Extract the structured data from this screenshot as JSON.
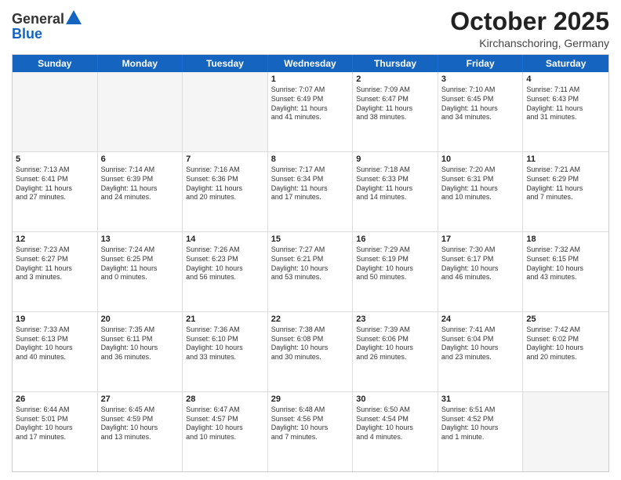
{
  "header": {
    "logo_general": "General",
    "logo_blue": "Blue",
    "month_title": "October 2025",
    "location": "Kirchanschoring, Germany"
  },
  "days_of_week": [
    "Sunday",
    "Monday",
    "Tuesday",
    "Wednesday",
    "Thursday",
    "Friday",
    "Saturday"
  ],
  "weeks": [
    [
      {
        "day": "",
        "lines": [],
        "empty": true
      },
      {
        "day": "",
        "lines": [],
        "empty": true
      },
      {
        "day": "",
        "lines": [],
        "empty": true
      },
      {
        "day": "1",
        "lines": [
          "Sunrise: 7:07 AM",
          "Sunset: 6:49 PM",
          "Daylight: 11 hours",
          "and 41 minutes."
        ]
      },
      {
        "day": "2",
        "lines": [
          "Sunrise: 7:09 AM",
          "Sunset: 6:47 PM",
          "Daylight: 11 hours",
          "and 38 minutes."
        ]
      },
      {
        "day": "3",
        "lines": [
          "Sunrise: 7:10 AM",
          "Sunset: 6:45 PM",
          "Daylight: 11 hours",
          "and 34 minutes."
        ]
      },
      {
        "day": "4",
        "lines": [
          "Sunrise: 7:11 AM",
          "Sunset: 6:43 PM",
          "Daylight: 11 hours",
          "and 31 minutes."
        ]
      }
    ],
    [
      {
        "day": "5",
        "lines": [
          "Sunrise: 7:13 AM",
          "Sunset: 6:41 PM",
          "Daylight: 11 hours",
          "and 27 minutes."
        ]
      },
      {
        "day": "6",
        "lines": [
          "Sunrise: 7:14 AM",
          "Sunset: 6:39 PM",
          "Daylight: 11 hours",
          "and 24 minutes."
        ]
      },
      {
        "day": "7",
        "lines": [
          "Sunrise: 7:16 AM",
          "Sunset: 6:36 PM",
          "Daylight: 11 hours",
          "and 20 minutes."
        ]
      },
      {
        "day": "8",
        "lines": [
          "Sunrise: 7:17 AM",
          "Sunset: 6:34 PM",
          "Daylight: 11 hours",
          "and 17 minutes."
        ]
      },
      {
        "day": "9",
        "lines": [
          "Sunrise: 7:18 AM",
          "Sunset: 6:33 PM",
          "Daylight: 11 hours",
          "and 14 minutes."
        ]
      },
      {
        "day": "10",
        "lines": [
          "Sunrise: 7:20 AM",
          "Sunset: 6:31 PM",
          "Daylight: 11 hours",
          "and 10 minutes."
        ]
      },
      {
        "day": "11",
        "lines": [
          "Sunrise: 7:21 AM",
          "Sunset: 6:29 PM",
          "Daylight: 11 hours",
          "and 7 minutes."
        ]
      }
    ],
    [
      {
        "day": "12",
        "lines": [
          "Sunrise: 7:23 AM",
          "Sunset: 6:27 PM",
          "Daylight: 11 hours",
          "and 3 minutes."
        ]
      },
      {
        "day": "13",
        "lines": [
          "Sunrise: 7:24 AM",
          "Sunset: 6:25 PM",
          "Daylight: 11 hours",
          "and 0 minutes."
        ]
      },
      {
        "day": "14",
        "lines": [
          "Sunrise: 7:26 AM",
          "Sunset: 6:23 PM",
          "Daylight: 10 hours",
          "and 56 minutes."
        ]
      },
      {
        "day": "15",
        "lines": [
          "Sunrise: 7:27 AM",
          "Sunset: 6:21 PM",
          "Daylight: 10 hours",
          "and 53 minutes."
        ]
      },
      {
        "day": "16",
        "lines": [
          "Sunrise: 7:29 AM",
          "Sunset: 6:19 PM",
          "Daylight: 10 hours",
          "and 50 minutes."
        ]
      },
      {
        "day": "17",
        "lines": [
          "Sunrise: 7:30 AM",
          "Sunset: 6:17 PM",
          "Daylight: 10 hours",
          "and 46 minutes."
        ]
      },
      {
        "day": "18",
        "lines": [
          "Sunrise: 7:32 AM",
          "Sunset: 6:15 PM",
          "Daylight: 10 hours",
          "and 43 minutes."
        ]
      }
    ],
    [
      {
        "day": "19",
        "lines": [
          "Sunrise: 7:33 AM",
          "Sunset: 6:13 PM",
          "Daylight: 10 hours",
          "and 40 minutes."
        ]
      },
      {
        "day": "20",
        "lines": [
          "Sunrise: 7:35 AM",
          "Sunset: 6:11 PM",
          "Daylight: 10 hours",
          "and 36 minutes."
        ]
      },
      {
        "day": "21",
        "lines": [
          "Sunrise: 7:36 AM",
          "Sunset: 6:10 PM",
          "Daylight: 10 hours",
          "and 33 minutes."
        ]
      },
      {
        "day": "22",
        "lines": [
          "Sunrise: 7:38 AM",
          "Sunset: 6:08 PM",
          "Daylight: 10 hours",
          "and 30 minutes."
        ]
      },
      {
        "day": "23",
        "lines": [
          "Sunrise: 7:39 AM",
          "Sunset: 6:06 PM",
          "Daylight: 10 hours",
          "and 26 minutes."
        ]
      },
      {
        "day": "24",
        "lines": [
          "Sunrise: 7:41 AM",
          "Sunset: 6:04 PM",
          "Daylight: 10 hours",
          "and 23 minutes."
        ]
      },
      {
        "day": "25",
        "lines": [
          "Sunrise: 7:42 AM",
          "Sunset: 6:02 PM",
          "Daylight: 10 hours",
          "and 20 minutes."
        ]
      }
    ],
    [
      {
        "day": "26",
        "lines": [
          "Sunrise: 6:44 AM",
          "Sunset: 5:01 PM",
          "Daylight: 10 hours",
          "and 17 minutes."
        ]
      },
      {
        "day": "27",
        "lines": [
          "Sunrise: 6:45 AM",
          "Sunset: 4:59 PM",
          "Daylight: 10 hours",
          "and 13 minutes."
        ]
      },
      {
        "day": "28",
        "lines": [
          "Sunrise: 6:47 AM",
          "Sunset: 4:57 PM",
          "Daylight: 10 hours",
          "and 10 minutes."
        ]
      },
      {
        "day": "29",
        "lines": [
          "Sunrise: 6:48 AM",
          "Sunset: 4:56 PM",
          "Daylight: 10 hours",
          "and 7 minutes."
        ]
      },
      {
        "day": "30",
        "lines": [
          "Sunrise: 6:50 AM",
          "Sunset: 4:54 PM",
          "Daylight: 10 hours",
          "and 4 minutes."
        ]
      },
      {
        "day": "31",
        "lines": [
          "Sunrise: 6:51 AM",
          "Sunset: 4:52 PM",
          "Daylight: 10 hours",
          "and 1 minute."
        ]
      },
      {
        "day": "",
        "lines": [],
        "empty": true
      }
    ]
  ]
}
